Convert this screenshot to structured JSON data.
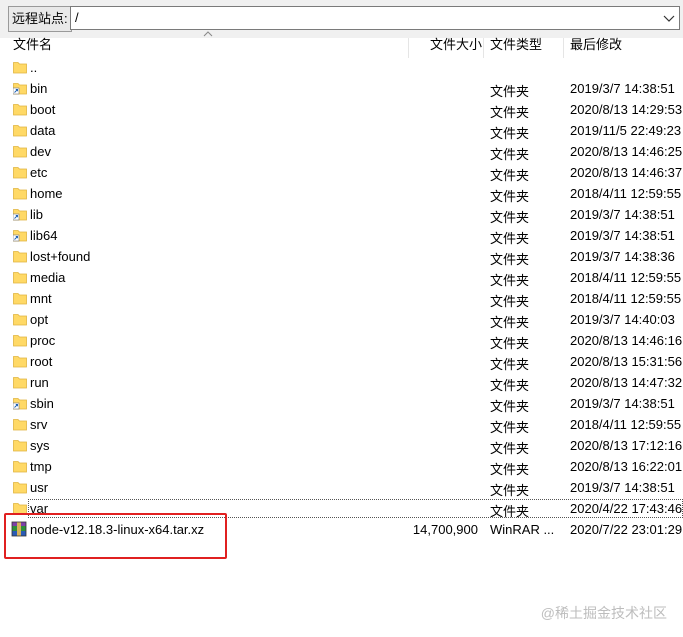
{
  "path_bar": {
    "label": "远程站点:",
    "value": "/"
  },
  "columns": {
    "name": "文件名",
    "size": "文件大小",
    "type": "文件类型",
    "modified": "最后修改"
  },
  "rows": [
    {
      "name": "..",
      "size": "",
      "type": "",
      "modified": "",
      "icon": "folder-icon"
    },
    {
      "name": "bin",
      "size": "",
      "type": "文件夹",
      "modified": "2019/3/7 14:38:51",
      "icon": "folder-link-icon"
    },
    {
      "name": "boot",
      "size": "",
      "type": "文件夹",
      "modified": "2020/8/13 14:29:53",
      "icon": "folder-icon"
    },
    {
      "name": "data",
      "size": "",
      "type": "文件夹",
      "modified": "2019/11/5 22:49:23",
      "icon": "folder-icon"
    },
    {
      "name": "dev",
      "size": "",
      "type": "文件夹",
      "modified": "2020/8/13 14:46:25",
      "icon": "folder-icon"
    },
    {
      "name": "etc",
      "size": "",
      "type": "文件夹",
      "modified": "2020/8/13 14:46:37",
      "icon": "folder-icon"
    },
    {
      "name": "home",
      "size": "",
      "type": "文件夹",
      "modified": "2018/4/11 12:59:55",
      "icon": "folder-icon"
    },
    {
      "name": "lib",
      "size": "",
      "type": "文件夹",
      "modified": "2019/3/7 14:38:51",
      "icon": "folder-link-icon"
    },
    {
      "name": "lib64",
      "size": "",
      "type": "文件夹",
      "modified": "2019/3/7 14:38:51",
      "icon": "folder-link-icon"
    },
    {
      "name": "lost+found",
      "size": "",
      "type": "文件夹",
      "modified": "2019/3/7 14:38:36",
      "icon": "folder-icon"
    },
    {
      "name": "media",
      "size": "",
      "type": "文件夹",
      "modified": "2018/4/11 12:59:55",
      "icon": "folder-icon"
    },
    {
      "name": "mnt",
      "size": "",
      "type": "文件夹",
      "modified": "2018/4/11 12:59:55",
      "icon": "folder-icon"
    },
    {
      "name": "opt",
      "size": "",
      "type": "文件夹",
      "modified": "2019/3/7 14:40:03",
      "icon": "folder-icon"
    },
    {
      "name": "proc",
      "size": "",
      "type": "文件夹",
      "modified": "2020/8/13 14:46:16",
      "icon": "folder-icon"
    },
    {
      "name": "root",
      "size": "",
      "type": "文件夹",
      "modified": "2020/8/13 15:31:56",
      "icon": "folder-icon"
    },
    {
      "name": "run",
      "size": "",
      "type": "文件夹",
      "modified": "2020/8/13 14:47:32",
      "icon": "folder-icon"
    },
    {
      "name": "sbin",
      "size": "",
      "type": "文件夹",
      "modified": "2019/3/7 14:38:51",
      "icon": "folder-link-icon"
    },
    {
      "name": "srv",
      "size": "",
      "type": "文件夹",
      "modified": "2018/4/11 12:59:55",
      "icon": "folder-icon"
    },
    {
      "name": "sys",
      "size": "",
      "type": "文件夹",
      "modified": "2020/8/13 17:12:16",
      "icon": "folder-icon"
    },
    {
      "name": "tmp",
      "size": "",
      "type": "文件夹",
      "modified": "2020/8/13 16:22:01",
      "icon": "folder-icon"
    },
    {
      "name": "usr",
      "size": "",
      "type": "文件夹",
      "modified": "2019/3/7 14:38:51",
      "icon": "folder-icon"
    },
    {
      "name": "var",
      "size": "",
      "type": "文件夹",
      "modified": "2020/4/22 17:43:46",
      "icon": "folder-icon"
    },
    {
      "name": "node-v12.18.3-linux-x64.tar.xz",
      "size": "14,700,900",
      "type": "WinRAR ...",
      "modified": "2020/7/22 23:01:29",
      "icon": "winrar-archive-icon"
    }
  ],
  "focused_row": "var",
  "highlighted_row": "node-v12.18.3-linux-x64.tar.xz",
  "watermark": "@稀土掘金技术社区",
  "colors": {
    "highlight_box": "#e02020",
    "folder": "#ffd966"
  }
}
